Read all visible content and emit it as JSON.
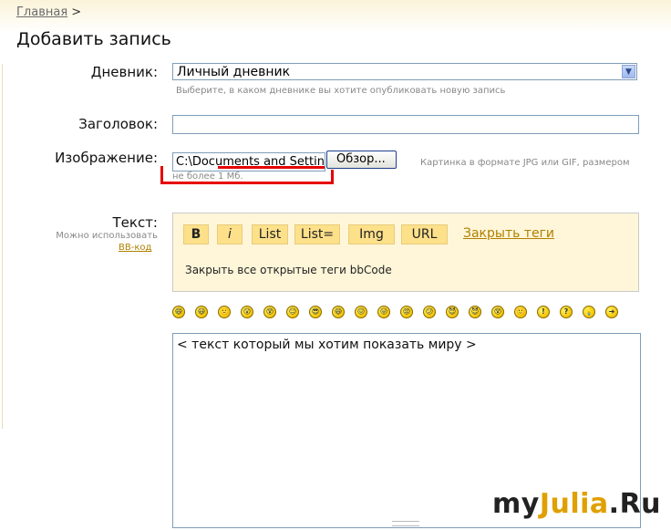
{
  "breadcrumb": {
    "home": "Главная",
    "separator": ">"
  },
  "page_title": "Добавить запись",
  "diary": {
    "label": "Дневник:",
    "selected": "Личный дневник",
    "hint": "Выберите, в каком дневнике вы хотите опубликовать новую запись"
  },
  "title_field": {
    "label": "Заголовок:"
  },
  "image": {
    "label": "Изображение:",
    "value": "C:\\Documents and Settin",
    "browse_label": "Обзор...",
    "hint_line1": "Картинка в формате JPG или GIF, размером",
    "hint_line2": "не более 1 Мб."
  },
  "text": {
    "label": "Текст:",
    "hint_line1": "Можно использовать",
    "hint_link": "BB-код",
    "bb_buttons": [
      "B",
      "i",
      "List",
      "List=",
      "Img",
      "URL"
    ],
    "close_tags": "Закрыть теги",
    "close_all": "Закрыть все открытые теги bbCode",
    "content": "< текст который мы хотим показать миру >"
  },
  "smileys": [
    "😄",
    "😃",
    "🙁",
    "😮",
    "😵",
    "😐",
    "😎",
    "😆",
    "😖",
    "😛",
    "😡",
    "😕",
    "😈",
    "😈",
    "😵",
    "🙂",
    "!",
    "?",
    "💡",
    "➜"
  ],
  "watermark": {
    "part1": "my",
    "part2": "Julia",
    "part3": ".Ru"
  },
  "colors": {
    "accent": "#fde08a",
    "panel": "#fff6d9",
    "link": "#b08000",
    "mark": "#e60000"
  }
}
